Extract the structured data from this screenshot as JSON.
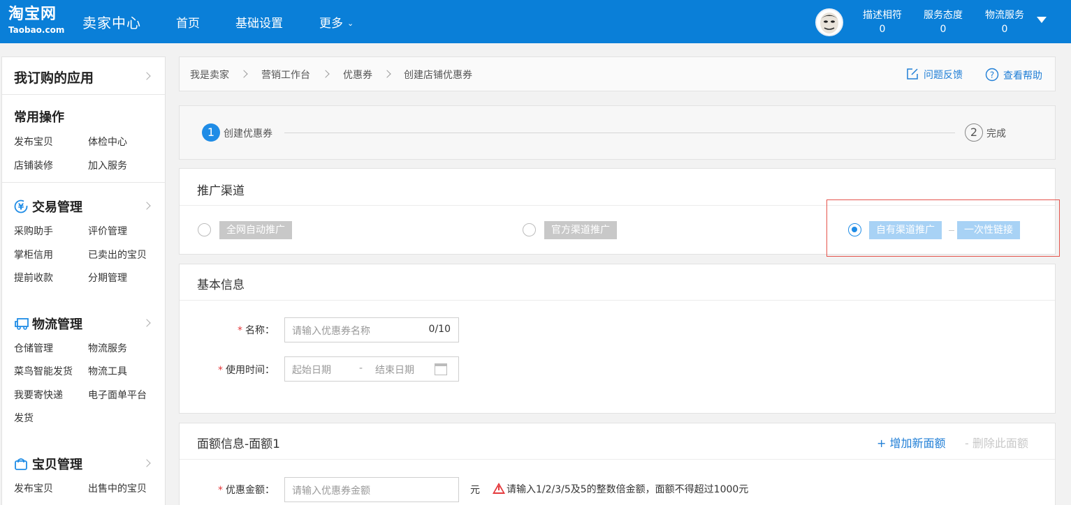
{
  "topbar": {
    "logo_cn": "淘宝网",
    "logo_en": "Taobao.com",
    "center": "卖家中心",
    "nav": [
      {
        "label": "首页"
      },
      {
        "label": "基础设置"
      },
      {
        "label": "更多"
      }
    ],
    "scores": [
      {
        "label": "描述相符",
        "value": "0"
      },
      {
        "label": "服务态度",
        "value": "0"
      },
      {
        "label": "物流服务",
        "value": "0"
      }
    ]
  },
  "sidebar": {
    "subscribed": "我订购的应用",
    "common": {
      "title": "常用操作",
      "items": [
        "发布宝贝",
        "体检中心",
        "店铺装修",
        "加入服务"
      ]
    },
    "trade": {
      "title": "交易管理",
      "icon": "yen-icon",
      "items": [
        "采购助手",
        "评价管理",
        "掌柜信用",
        "已卖出的宝贝",
        "提前收款",
        "分期管理"
      ]
    },
    "logistics": {
      "title": "物流管理",
      "icon": "truck-icon",
      "items": [
        "仓储管理",
        "物流服务",
        "菜鸟智能发货",
        "物流工具",
        "我要寄快递",
        "电子面单平台",
        "发货"
      ]
    },
    "goods": {
      "title": "宝贝管理",
      "icon": "bag-icon",
      "items": [
        "发布宝贝",
        "出售中的宝贝"
      ]
    }
  },
  "breadcrumb": {
    "items": [
      "我是卖家",
      "营销工作台",
      "优惠券",
      "创建店铺优惠券"
    ],
    "feedback": "问题反馈",
    "help": "查看帮助"
  },
  "steps": {
    "step1_num": "1",
    "step1_label": "创建优惠券",
    "step2_num": "2",
    "step2_label": "完成"
  },
  "channel": {
    "title": "推广渠道",
    "options": [
      {
        "label": "全网自动推广",
        "selected": false
      },
      {
        "label": "官方渠道推广",
        "selected": false
      },
      {
        "label": "自有渠道推广",
        "selected": true,
        "sub": "一次性链接"
      }
    ]
  },
  "basic": {
    "title": "基本信息",
    "name_label": "名称：",
    "name_placeholder": "请输入优惠券名称",
    "name_count": "0/10",
    "time_label": "使用时间：",
    "start_placeholder": "起始日期",
    "sep": "-",
    "end_placeholder": "结束日期"
  },
  "amount": {
    "title": "面额信息-面额1",
    "add": "+ 增加新面额",
    "delete": "- 删除此面额",
    "amount_label": "优惠金额：",
    "amount_placeholder": "请输入优惠券金额",
    "unit": "元",
    "warning": "请输入1/2/3/5及5的整数倍金额，面额不得超过1000元"
  },
  "colors": {
    "topbar": "#0a7fd8",
    "accent": "#1f8ce6",
    "highlight": "#e5534b",
    "required": "#e4393c"
  }
}
